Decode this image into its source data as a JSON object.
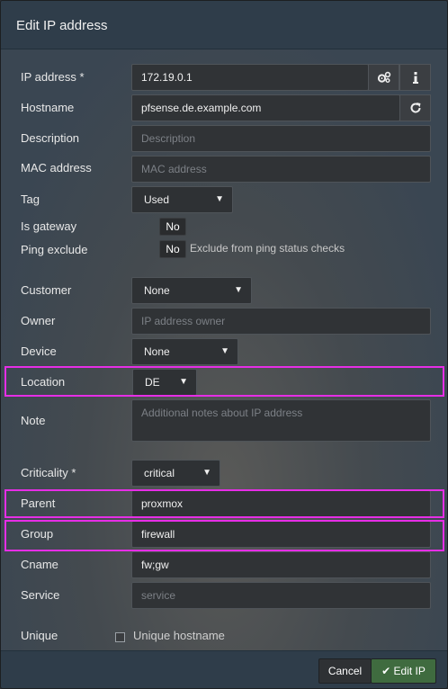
{
  "modal": {
    "title": "Edit IP address"
  },
  "fields": {
    "ip_address": {
      "label": "IP address *",
      "value": "172.19.0.1"
    },
    "hostname": {
      "label": "Hostname",
      "value": "pfsense.de.example.com"
    },
    "description": {
      "label": "Description",
      "placeholder": "Description"
    },
    "mac": {
      "label": "MAC address",
      "placeholder": "MAC address"
    },
    "tag": {
      "label": "Tag",
      "selected": "Used"
    },
    "is_gateway": {
      "label": "Is gateway",
      "value": "No"
    },
    "ping_exclude": {
      "label": "Ping exclude",
      "value": "No",
      "hint": "Exclude from ping status checks"
    },
    "customer": {
      "label": "Customer",
      "selected": "None"
    },
    "owner": {
      "label": "Owner",
      "placeholder": "IP address owner"
    },
    "device": {
      "label": "Device",
      "selected": "None"
    },
    "location": {
      "label": "Location",
      "selected": "DE"
    },
    "note": {
      "label": "Note",
      "placeholder": "Additional notes about IP address"
    },
    "criticality": {
      "label": "Criticality *",
      "selected": "critical"
    },
    "parent": {
      "label": "Parent",
      "value": "proxmox"
    },
    "group": {
      "label": "Group",
      "value": "firewall"
    },
    "cname": {
      "label": "Cname",
      "value": "fw;gw"
    },
    "service": {
      "label": "Service",
      "placeholder": "service"
    },
    "unique": {
      "label": "Unique",
      "checkbox_label": "Unique hostname",
      "checked": false
    }
  },
  "footer": {
    "cancel_label": "Cancel",
    "submit_label": "Edit IP"
  },
  "colors": {
    "highlight": "#e62ee6",
    "submit_bg": "#3f6b3f"
  },
  "icons": [
    "gears-icon",
    "info-icon",
    "refresh-icon",
    "chevron-down-icon",
    "check-icon"
  ]
}
